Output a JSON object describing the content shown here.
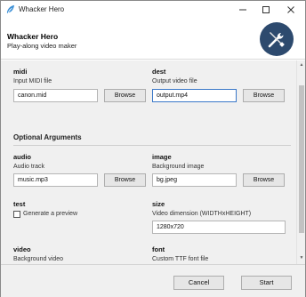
{
  "window": {
    "title": "Whacker Hero",
    "icon": "feather-icon",
    "controls": {
      "minimize": "—",
      "maximize": "☐",
      "close": "✕"
    }
  },
  "header": {
    "title": "Whacker Hero",
    "subtitle": "Play-along video maker",
    "logo_icon": "tools-icon",
    "logo_color": "#2d4a6e"
  },
  "required": {
    "midi": {
      "name": "midi",
      "help": "Input MIDI file",
      "value": "canon.mid",
      "button": "Browse"
    },
    "dest": {
      "name": "dest",
      "help": "Output video file",
      "value": "output.mp4",
      "button": "Browse"
    }
  },
  "optional": {
    "section_title": "Optional Arguments",
    "audio": {
      "name": "audio",
      "help": "Audio track",
      "value": "music.mp3",
      "button": "Browse"
    },
    "image": {
      "name": "image",
      "help": "Background image",
      "value": "bg.jpeg",
      "button": "Browse"
    },
    "test": {
      "name": "test",
      "checkbox_label": "Generate a preview",
      "checked": false
    },
    "size": {
      "name": "size",
      "help": "Video dimension (WIDTHxHEIGHT)",
      "value": "1280x720"
    },
    "video": {
      "name": "video",
      "help": "Background video"
    },
    "font": {
      "name": "font",
      "help": "Custom TTF font file"
    }
  },
  "footer": {
    "cancel": "Cancel",
    "start": "Start"
  }
}
